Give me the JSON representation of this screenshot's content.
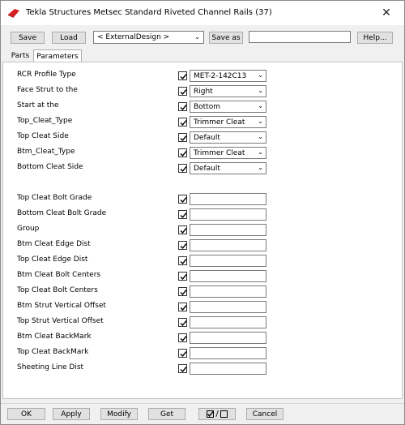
{
  "window": {
    "title": "Tekla Structures  Metsec Standard Riveted Channel Rails (37)"
  },
  "toolbar": {
    "save_label": "Save",
    "load_label": "Load",
    "design_selected": "< ExternalDesign >",
    "save_as_label": "Save as",
    "save_as_value": "",
    "help_label": "Help..."
  },
  "tabs": [
    {
      "label": "Parts"
    },
    {
      "label": "Parameters"
    }
  ],
  "rows": [
    {
      "label": "RCR Profile Type",
      "value": "MET-2-142C13",
      "checked": true
    },
    {
      "label": "Face Strut to the",
      "value": "Right",
      "checked": true
    },
    {
      "label": "Start at the",
      "value": "Bottom",
      "checked": true
    },
    {
      "label": "Top_Cleat_Type",
      "value": "Trimmer Cleat",
      "checked": true
    },
    {
      "label": "Top Cleat Side",
      "value": "Default",
      "checked": true
    },
    {
      "label": "Btm_Cleat_Type",
      "value": "Trimmer Cleat",
      "checked": true
    },
    {
      "label": "Bottom Cleat Side",
      "value": "Default",
      "checked": true
    },
    {
      "label": "Top Cleat Bolt Grade",
      "value": "",
      "checked": true
    },
    {
      "label": "Bottom Cleat Bolt Grade",
      "value": "",
      "checked": true
    },
    {
      "label": "Group",
      "value": "",
      "checked": true
    },
    {
      "label": "Btm Cleat Edge Dist",
      "value": "",
      "checked": true
    },
    {
      "label": "Top Cleat Edge Dist",
      "value": "",
      "checked": true
    },
    {
      "label": "Btm Cleat Bolt Centers",
      "value": "",
      "checked": true
    },
    {
      "label": "Top Cleat Bolt Centers",
      "value": "",
      "checked": true
    },
    {
      "label": "Btm Strut Vertical Offset",
      "value": "",
      "checked": true
    },
    {
      "label": "Top Strut Vertical Offset",
      "value": "",
      "checked": true
    },
    {
      "label": "Btm Cleat BackMark",
      "value": "",
      "checked": true
    },
    {
      "label": "Top Cleat BackMark",
      "value": "",
      "checked": true
    },
    {
      "label": "Sheeting Line Dist",
      "value": "",
      "checked": true
    }
  ],
  "footer": {
    "ok_label": "OK",
    "apply_label": "Apply",
    "modify_label": "Modify",
    "get_label": "Get",
    "toggle_separator": "/",
    "cancel_label": "Cancel"
  },
  "icons": {
    "app_logo": "tekla-logo-icon",
    "close": "close-icon",
    "dropdown": "chevron-down-icon",
    "check": "checkmark-icon"
  },
  "colors": {
    "logo_red": "#d42020",
    "window_bg": "#f0f0f0",
    "panel_bg": "#ffffff",
    "button_bg": "#e1e1e1"
  }
}
